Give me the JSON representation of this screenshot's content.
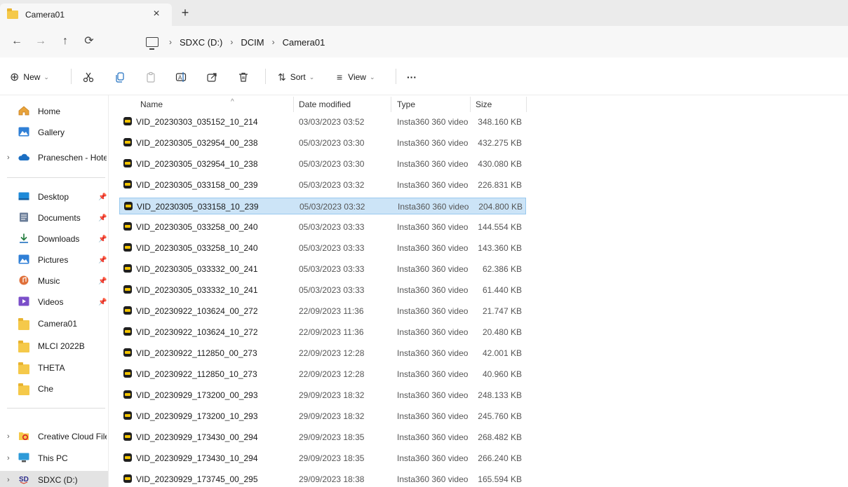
{
  "tab": {
    "title": "Camera01",
    "close": "×",
    "new": "+"
  },
  "nav": {
    "back": "←",
    "forward": "→",
    "up": "↑",
    "refresh": "⟳"
  },
  "breadcrumb": {
    "sep": "›",
    "items": [
      "SDXC (D:)",
      "DCIM",
      "Camera01"
    ]
  },
  "toolbar": {
    "new_label": "New",
    "sort_label": "Sort",
    "view_label": "View",
    "more": "···",
    "icons": [
      "cut-icon",
      "copy-icon",
      "paste-icon",
      "rename-icon",
      "share-icon",
      "delete-icon"
    ]
  },
  "sidebar": {
    "top": [
      {
        "label": "Home",
        "icon": "home-icon"
      },
      {
        "label": "Gallery",
        "icon": "gallery-icon"
      },
      {
        "label": "Praneschen - Hotel",
        "icon": "cloud-icon",
        "expander": "›"
      }
    ],
    "pinned": [
      {
        "label": "Desktop",
        "icon": "desktop-icon"
      },
      {
        "label": "Documents",
        "icon": "documents-icon"
      },
      {
        "label": "Downloads",
        "icon": "downloads-icon"
      },
      {
        "label": "Pictures",
        "icon": "pictures-icon"
      },
      {
        "label": "Music",
        "icon": "music-icon"
      },
      {
        "label": "Videos",
        "icon": "videos-icon"
      }
    ],
    "folders": [
      {
        "label": "Camera01"
      },
      {
        "label": "MLCI 2022B"
      },
      {
        "label": "THETA"
      },
      {
        "label": "Che"
      }
    ],
    "bottom": [
      {
        "label": "Creative Cloud Files",
        "icon": "creative-cloud-icon",
        "expander": "›"
      },
      {
        "label": "This PC",
        "icon": "pc-icon",
        "expander": "›"
      },
      {
        "label": "SDXC (D:)",
        "icon": "sd-card-icon",
        "expander": "›"
      }
    ]
  },
  "columns": {
    "name": "Name",
    "date": "Date modified",
    "type": "Type",
    "size": "Size",
    "sort_indicator": "^"
  },
  "files": [
    {
      "name": "VID_20230303_035152_10_214",
      "date": "03/03/2023 03:52",
      "type": "Insta360 360 video",
      "size": "348.160 KB"
    },
    {
      "name": "VID_20230305_032954_00_238",
      "date": "05/03/2023 03:30",
      "type": "Insta360 360 video",
      "size": "432.275 KB"
    },
    {
      "name": "VID_20230305_032954_10_238",
      "date": "05/03/2023 03:30",
      "type": "Insta360 360 video",
      "size": "430.080 KB"
    },
    {
      "name": "VID_20230305_033158_00_239",
      "date": "05/03/2023 03:32",
      "type": "Insta360 360 video",
      "size": "226.831 KB"
    },
    {
      "name": "VID_20230305_033158_10_239",
      "date": "05/03/2023 03:32",
      "type": "Insta360 360 video",
      "size": "204.800 KB"
    },
    {
      "name": "VID_20230305_033258_00_240",
      "date": "05/03/2023 03:33",
      "type": "Insta360 360 video",
      "size": "144.554 KB"
    },
    {
      "name": "VID_20230305_033258_10_240",
      "date": "05/03/2023 03:33",
      "type": "Insta360 360 video",
      "size": "143.360 KB"
    },
    {
      "name": "VID_20230305_033332_00_241",
      "date": "05/03/2023 03:33",
      "type": "Insta360 360 video",
      "size": "62.386 KB"
    },
    {
      "name": "VID_20230305_033332_10_241",
      "date": "05/03/2023 03:33",
      "type": "Insta360 360 video",
      "size": "61.440 KB"
    },
    {
      "name": "VID_20230922_103624_00_272",
      "date": "22/09/2023 11:36",
      "type": "Insta360 360 video",
      "size": "21.747 KB"
    },
    {
      "name": "VID_20230922_103624_10_272",
      "date": "22/09/2023 11:36",
      "type": "Insta360 360 video",
      "size": "20.480 KB"
    },
    {
      "name": "VID_20230922_112850_00_273",
      "date": "22/09/2023 12:28",
      "type": "Insta360 360 video",
      "size": "42.001 KB"
    },
    {
      "name": "VID_20230922_112850_10_273",
      "date": "22/09/2023 12:28",
      "type": "Insta360 360 video",
      "size": "40.960 KB"
    },
    {
      "name": "VID_20230929_173200_00_293",
      "date": "29/09/2023 18:32",
      "type": "Insta360 360 video",
      "size": "248.133 KB"
    },
    {
      "name": "VID_20230929_173200_10_293",
      "date": "29/09/2023 18:32",
      "type": "Insta360 360 video",
      "size": "245.760 KB"
    },
    {
      "name": "VID_20230929_173430_00_294",
      "date": "29/09/2023 18:35",
      "type": "Insta360 360 video",
      "size": "268.482 KB"
    },
    {
      "name": "VID_20230929_173430_10_294",
      "date": "29/09/2023 18:35",
      "type": "Insta360 360 video",
      "size": "266.240 KB"
    },
    {
      "name": "VID_20230929_173745_00_295",
      "date": "29/09/2023 18:38",
      "type": "Insta360 360 video",
      "size": "165.594 KB"
    }
  ],
  "selected_file": "VID_20230305_033158_10_239",
  "colors": {
    "selection_bg": "#cce4f7",
    "selection_border": "#99c9ef",
    "folder": "#f5c94a",
    "accent": "#0067c0"
  }
}
